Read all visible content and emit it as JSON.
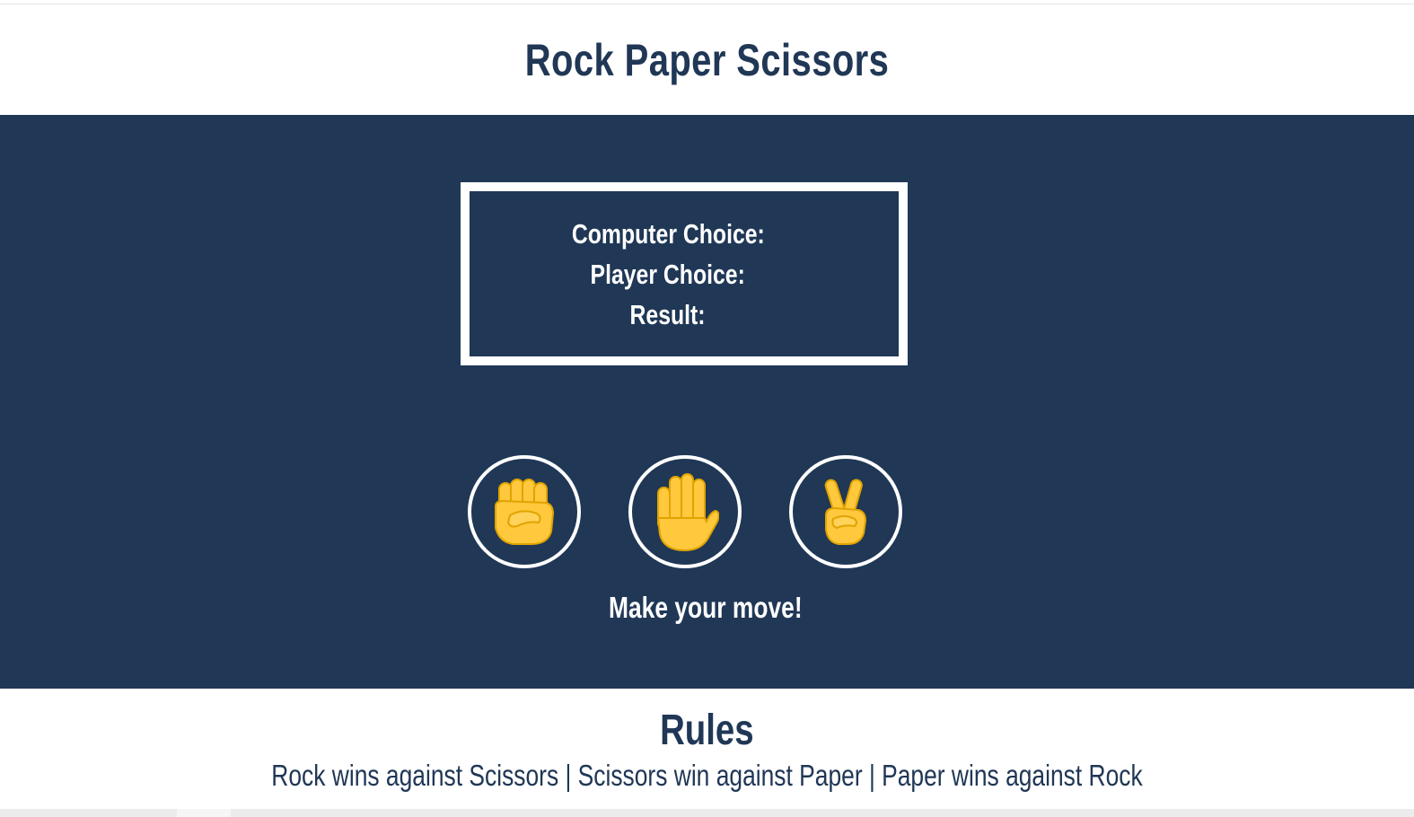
{
  "header": {
    "title": "Rock Paper Scissors"
  },
  "scoreboard": {
    "computer_choice_label": "Computer Choice:",
    "player_choice_label": "Player Choice:",
    "result_label": "Result:"
  },
  "choices": [
    {
      "name": "Rock",
      "icon": "raised-fist-icon"
    },
    {
      "name": "Paper",
      "icon": "raised-hand-icon"
    },
    {
      "name": "Scissors",
      "icon": "victory-hand-icon"
    }
  ],
  "prompt": "Make your move!",
  "rules": {
    "heading": "Rules",
    "text": "Rock wins against Scissors | Scissors win against Paper | Paper wins against Rock"
  },
  "colors": {
    "primary": "#203756",
    "background": "#ffffff",
    "emoji_skin": "#FFC83D",
    "emoji_shade": "#E0A400"
  }
}
